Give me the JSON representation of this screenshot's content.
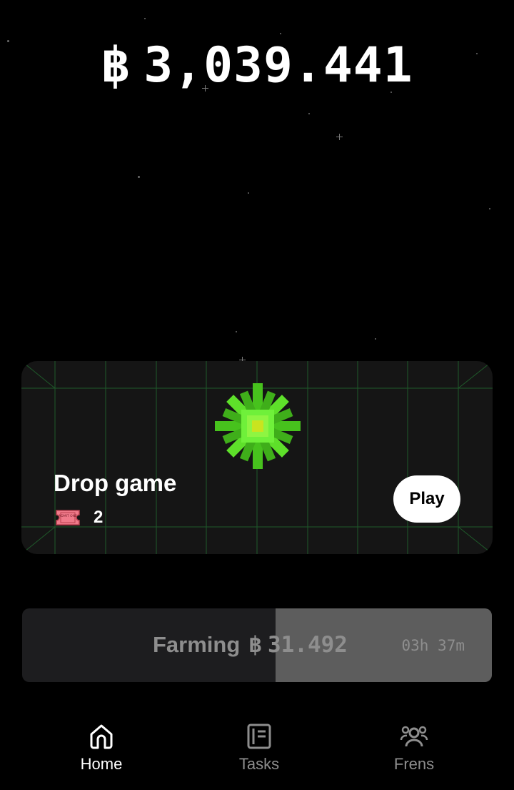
{
  "balance": {
    "symbol": "฿",
    "amount": "3,039.441"
  },
  "drop_game": {
    "title": "Drop game",
    "ticket_icon": "admit-one-ticket-icon",
    "ticket_text": "ADMIT ONE",
    "ticket_count": "2",
    "play_label": "Play",
    "accent_color": "#5ee02a"
  },
  "farming": {
    "label": "Farming",
    "symbol": "฿",
    "amount": "31.492",
    "time_left": "03h 37m",
    "progress_percent": 46
  },
  "nav": {
    "items": [
      {
        "label": "Home",
        "icon": "home-icon",
        "active": true
      },
      {
        "label": "Tasks",
        "icon": "tasks-icon",
        "active": false
      },
      {
        "label": "Frens",
        "icon": "frens-icon",
        "active": false
      }
    ]
  }
}
